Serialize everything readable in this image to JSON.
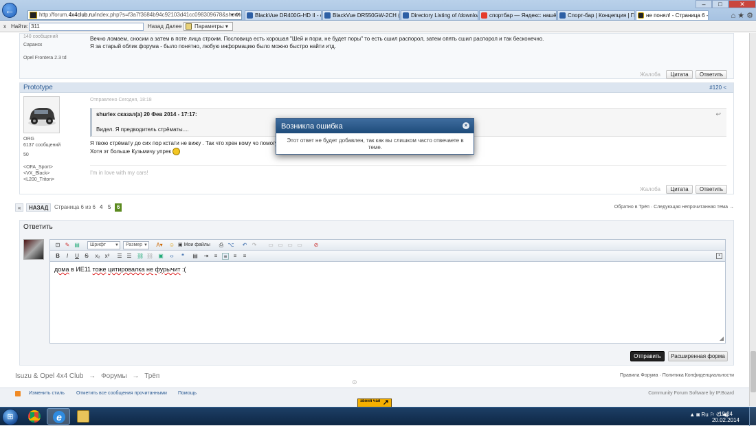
{
  "browser": {
    "url_prefix": "http://forum.",
    "url_host": "4x4club.ru",
    "url_rest": "/index.php?s=f3a7f3684b94c92103d41cc098309678&showtopic=",
    "url_controls": "▾ ⟳",
    "tabs": [
      "BlackVue DR400G-HD II - стр. ...",
      "BlackVue DR550GW-2CH (2-к...",
      "Directory Listing of /download...",
      "спортбар — Яндекс: нашёлс...",
      "Спорт-бар | Концепция | ГК ...",
      "не понял! - Страница 6 - Т..."
    ],
    "window_controls": [
      "–",
      "□",
      "✕"
    ],
    "icons_right": "⌂ ★ ⚙"
  },
  "findbar": {
    "close": "x",
    "label": "Найти:",
    "value": "311",
    "prev": "Назад",
    "next": "Далее",
    "params": "Параметры ▾"
  },
  "post1": {
    "msgs_partial": "140 сообщений",
    "city": "Саранск",
    "car": "Opel Frontera 2.3 td",
    "line1": "Вечно ломаем, сносим  а затем в поте лица строим. Пословица есть хорошая \"Шей и пори, не будет поры\" то есть сшил распорол, затем опять сшил распорол и так бесконечно.",
    "line2": "Я за старый облик форума - было понятно, любую информацию было можно быстро найти итд.",
    "report": "Жалоба",
    "quote": "Цитата",
    "reply": "Ответить"
  },
  "post2": {
    "author": "Prototype",
    "num": "#120 <",
    "sent": "Отправлено Сегодня, 18:18",
    "group": "ORG",
    "msgs": "6137 сообщений",
    "rep": "50",
    "sig1": "<OFA_Sport>",
    "sig2": "<VX_Black>",
    "sig3": "<L200_Triton>",
    "quote_head": "shurlex сказал(а) 20 Фев 2014 - 17:17:",
    "quote_text": "Видел. Я предводитель стрёматы....",
    "line1": "Я твою стрёмату до сих пор кстати не вижу . Так что хрен кому чо помогу",
    "line2": "Хотя эт больше Кузьмичу упрек",
    "signature": "I'm in love with my cars!",
    "report": "Жалоба",
    "quote": "Цитата",
    "reply": "Ответить"
  },
  "pagination": {
    "prev_arrow": "«",
    "back": "НАЗАД",
    "info": "Страница 6 из 6",
    "p4": "4",
    "p5": "5",
    "p6": "6",
    "right": "Обратно в Трёп · Следующая непрочитанная тема →"
  },
  "reply": {
    "title": "Ответить",
    "font": "Шрифт",
    "size": "Размер",
    "smiles": "Мои файлы",
    "text_parts": [
      "дома",
      " в ИЕ11 ",
      "тоже",
      " ",
      "цитировалка",
      " ",
      "не",
      " ",
      "фурычит",
      " :("
    ],
    "submit": "Отправить",
    "advanced": "Расширенная форма"
  },
  "footer": {
    "crumb1": "Isuzu & Opel 4x4 Club",
    "sep": "→",
    "crumb2": "Форумы",
    "crumb3": "Трёп",
    "right": "Правила Форума · Политика Конфиденциальности",
    "style": "Изменить стиль",
    "mark_read": "Отметить все сообщения прочитанными",
    "help": "Помощь",
    "software": "Community Forum Software by IP.Board",
    "top_link": "⊙",
    "sponsor": "звоня чая"
  },
  "modal": {
    "title": "Возникла ошибка",
    "message": "Этот ответ не будет добавлен, так как вы слишком часто отвечаете в теме."
  },
  "taskbar": {
    "start": "⊞",
    "tray": "▲  ◙ Ru ⚐ ✆ ◀)",
    "time": "19:24",
    "date": "20.02.2014"
  }
}
